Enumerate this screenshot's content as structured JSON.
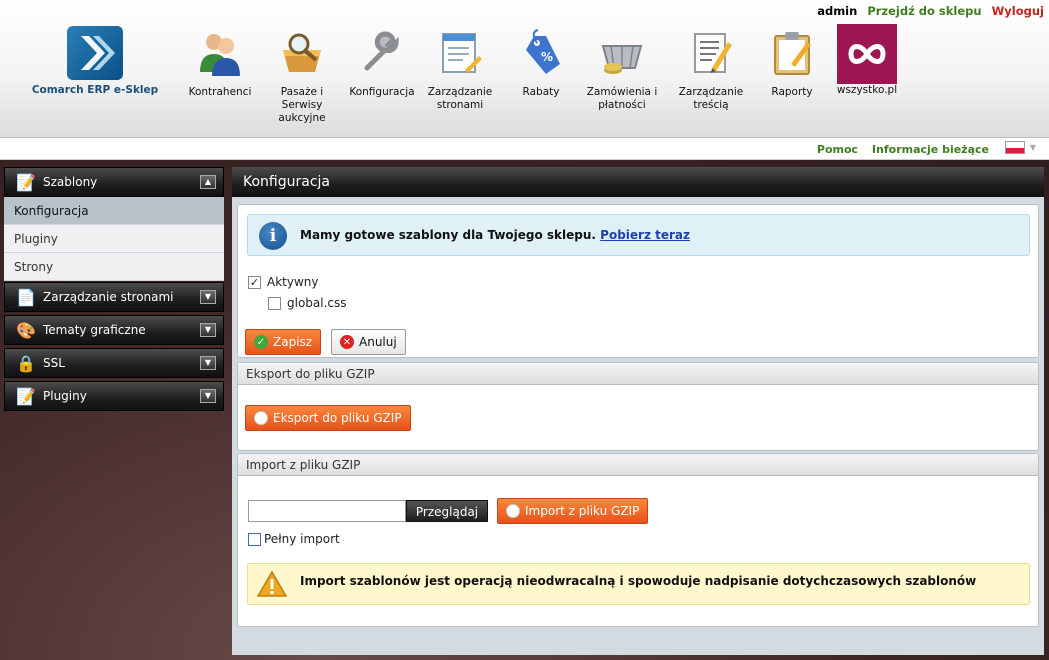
{
  "topbar": {
    "user": "admin",
    "go_to_shop": "Przejdź do sklepu",
    "logout": "Wyloguj"
  },
  "logo": {
    "text": "Comarch ERP e-Sklep"
  },
  "nav": [
    {
      "label": "Kontrahenci",
      "icon": "people-icon"
    },
    {
      "label": "Pasaże i Serwisy aukcyjne",
      "icon": "basket-magnifier-icon"
    },
    {
      "label": "Konfiguracja",
      "icon": "wrench-icon"
    },
    {
      "label": "Zarządzanie stronami",
      "icon": "page-edit-icon"
    },
    {
      "label": "Rabaty",
      "icon": "discount-tag-icon"
    },
    {
      "label": "Zamówienia i płatności",
      "icon": "shopping-basket-icon"
    },
    {
      "label": "Zarządzanie treścią",
      "icon": "content-edit-icon"
    },
    {
      "label": "Raporty",
      "icon": "clipboard-icon"
    },
    {
      "label": "wszystko.pl",
      "icon": "infinity-icon"
    }
  ],
  "subbar": {
    "help": "Pomoc",
    "current_info": "Informacje bieżące",
    "language_flag": "poland-flag-icon"
  },
  "sidebar": {
    "sections": [
      {
        "title": "Szablony",
        "icon": "notepad-icon",
        "expanded": true,
        "items": [
          {
            "label": "Konfiguracja",
            "active": true
          },
          {
            "label": "Pluginy",
            "active": false
          },
          {
            "label": "Strony",
            "active": false
          }
        ]
      },
      {
        "title": "Zarządzanie stronami",
        "icon": "page-icon",
        "expanded": false
      },
      {
        "title": "Tematy graficzne",
        "icon": "palette-icon",
        "expanded": false
      },
      {
        "title": "SSL",
        "icon": "lock-icon",
        "expanded": false
      },
      {
        "title": "Pluginy",
        "icon": "notepad-icon",
        "expanded": false
      }
    ]
  },
  "main": {
    "title": "Konfiguracja",
    "info": {
      "text": "Mamy gotowe szablony dla Twojego sklepu.",
      "link": "Pobierz teraz"
    },
    "active_checkbox": {
      "label": "Aktywny",
      "checked": true
    },
    "css_checkbox": {
      "label": "global.css",
      "checked": false
    },
    "save_label": "Zapisz",
    "cancel_label": "Anuluj",
    "export": {
      "title": "Eksport do pliku GZIP",
      "button": "Eksport do pliku GZIP"
    },
    "import": {
      "title": "Import z pliku GZIP",
      "file_value": "",
      "browse": "Przeglądaj",
      "button": "Import z pliku GZIP",
      "full_import": {
        "label": "Pełny import",
        "checked": false
      },
      "warning": "Import szablonów jest operacją nieodwracalną i spowoduje nadpisanie dotychczasowych szablonów"
    }
  },
  "colors": {
    "accent_orange": "#f26a2b",
    "link_green": "#3f7d1f",
    "logout_red": "#c0241b",
    "info_bg": "#dff1f7",
    "warn_bg": "#fff8cc",
    "wszystko_brand": "#9b1652"
  }
}
